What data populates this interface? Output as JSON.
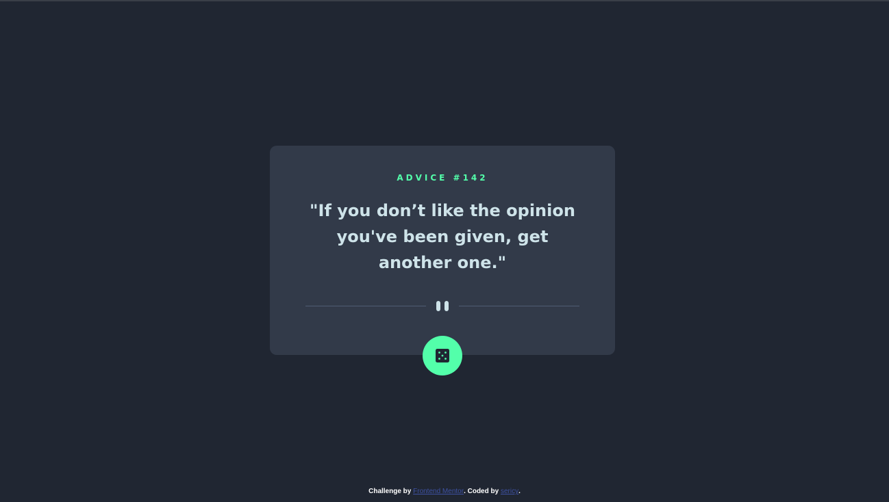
{
  "advice": {
    "label": "ADVICE #142",
    "quote": "\"If you don’t like the opinion you've been given, get another one.\""
  },
  "controls": {
    "generate_icon": "dice-icon",
    "divider_icon": "pause-icon"
  },
  "footer": {
    "prefix": "Challenge by ",
    "challenge_link": "Frontend Mentor",
    "middle": ". Coded by ",
    "author_link": "sericy",
    "suffix": "."
  },
  "colors": {
    "background": "#202632",
    "card": "#323a49",
    "accent": "#53ffaa",
    "text": "#cee3e9",
    "link": "#3e52a3"
  }
}
